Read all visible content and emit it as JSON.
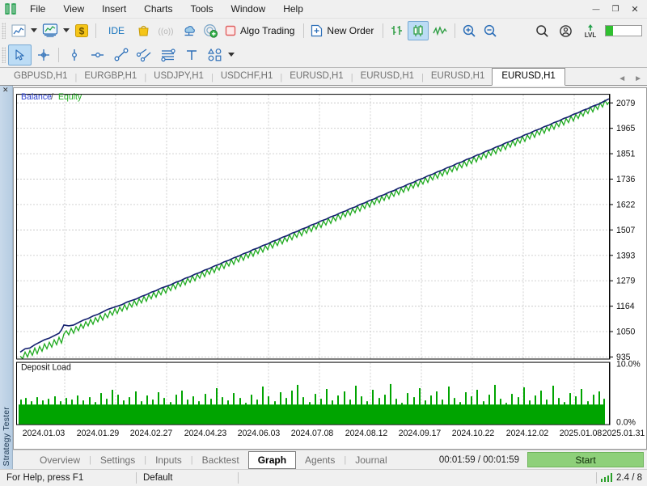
{
  "window": {
    "controls": [
      {
        "name": "minimize-button",
        "glyph": "—"
      },
      {
        "name": "restore-button",
        "glyph": "❐"
      },
      {
        "name": "close-button",
        "glyph": "✕"
      }
    ]
  },
  "menubar": {
    "logo_name": "metatrader-logo-icon",
    "items": [
      {
        "label": "File"
      },
      {
        "label": "View"
      },
      {
        "label": "Insert"
      },
      {
        "label": "Charts"
      },
      {
        "label": "Tools"
      },
      {
        "label": "Window"
      },
      {
        "label": "Help"
      }
    ]
  },
  "toolbar": {
    "items": [
      {
        "name": "chart-type-line-button",
        "icon": "line-chart-icon",
        "label": ""
      },
      {
        "name": "chart-type-dropdown",
        "icon": "chevron-down-icon",
        "label": ""
      },
      {
        "name": "templates-button",
        "icon": "template-chart-icon",
        "label": ""
      },
      {
        "name": "templates-dropdown",
        "icon": "chevron-down-icon",
        "label": ""
      },
      {
        "name": "toolbox-button",
        "icon": "dollar-box-icon",
        "label": ""
      },
      {
        "name": "ide-button",
        "icon": "",
        "label": "IDE"
      },
      {
        "name": "market-button",
        "icon": "shopping-bag-icon",
        "label": ""
      },
      {
        "name": "signals-button",
        "icon": "broadcast-icon",
        "label": ""
      },
      {
        "name": "vps-button",
        "icon": "cloud-icon",
        "label": ""
      },
      {
        "name": "copy-trading-button",
        "icon": "target-plus-icon",
        "label": ""
      },
      {
        "name": "algo-trading-button",
        "icon": "algo-square-icon",
        "label": "Algo Trading"
      },
      {
        "name": "new-order-button",
        "icon": "new-order-icon",
        "label": "New Order"
      },
      {
        "name": "bar-chart-button",
        "icon": "bar-chart-icon",
        "label": ""
      },
      {
        "name": "candlestick-chart-button",
        "icon": "candlestick-icon",
        "label": ""
      },
      {
        "name": "line-chart-button",
        "icon": "zigzag-line-icon",
        "label": ""
      },
      {
        "name": "zoom-in-button",
        "icon": "magnifier-plus-icon",
        "label": ""
      },
      {
        "name": "zoom-out-button",
        "icon": "magnifier-minus-icon",
        "label": ""
      }
    ],
    "algo_trading_label": "Algo Trading",
    "new_order_label": "New Order",
    "ide_label": "IDE",
    "search_icon": "search-icon",
    "account_icon": "account-circle-icon",
    "level_icon": "lvl-up-icon"
  },
  "drawing_toolbar": {
    "items": [
      {
        "name": "cursor-tool",
        "icon": "arrow-cursor-icon",
        "active": true
      },
      {
        "name": "crosshair-tool",
        "icon": "crosshair-icon",
        "active": false
      },
      {
        "name": "vertical-line-tool",
        "icon": "vertical-line-icon",
        "active": false
      },
      {
        "name": "horizontal-line-tool",
        "icon": "horizontal-line-icon",
        "active": false
      },
      {
        "name": "trendline-tool",
        "icon": "trendline-icon",
        "active": false
      },
      {
        "name": "equidistant-channel-tool",
        "icon": "channel-icon",
        "active": false
      },
      {
        "name": "fibonacci-tool",
        "icon": "fibonacci-icon",
        "active": false
      },
      {
        "name": "text-tool",
        "icon": "text-t-icon",
        "active": false
      },
      {
        "name": "shapes-tool",
        "icon": "shapes-icon",
        "active": false
      },
      {
        "name": "shapes-dropdown",
        "icon": "chevron-down-icon",
        "active": false
      }
    ]
  },
  "chart_tabs": {
    "tabs": [
      {
        "label": "GBPUSD,H1",
        "active": false
      },
      {
        "label": "EURGBP,H1",
        "active": false
      },
      {
        "label": "USDJPY,H1",
        "active": false
      },
      {
        "label": "USDCHF,H1",
        "active": false
      },
      {
        "label": "EURUSD,H1",
        "active": false
      },
      {
        "label": "EURUSD,H1",
        "active": false
      },
      {
        "label": "EURUSD,H1",
        "active": false
      },
      {
        "label": "EURUSD,H1",
        "active": true
      }
    ],
    "nav_prev": "◄",
    "nav_next": "►"
  },
  "side_panel": {
    "label": "Strategy Tester",
    "close_glyph": "✕"
  },
  "tester_tabs": {
    "tabs": [
      {
        "label": "Overview",
        "active": false
      },
      {
        "label": "Settings",
        "active": false
      },
      {
        "label": "Inputs",
        "active": false
      },
      {
        "label": "Backtest",
        "active": false
      },
      {
        "label": "Graph",
        "active": true
      },
      {
        "label": "Agents",
        "active": false
      },
      {
        "label": "Journal",
        "active": false
      }
    ],
    "timer": "00:01:59 / 00:01:59",
    "start_label": "Start"
  },
  "statusbar": {
    "help_text": "For Help, press F1",
    "profile": "Default",
    "connection": "2.4 / 8",
    "signal_icon": "signal-bars-icon"
  },
  "chart_data": {
    "type": "line",
    "title": "Balance / Equity",
    "legend": [
      {
        "label": "Balance",
        "color": "#1f2d86"
      },
      {
        "label": "/",
        "color": "#555555"
      },
      {
        "label": "Equity",
        "color": "#22aa22"
      }
    ],
    "xlabel": "",
    "ylabel": "",
    "grid": true,
    "legend_position": "top-left",
    "x_tick_labels": [
      "2024.01.03",
      "2024.01.29",
      "2024.02.27",
      "2024.04.23",
      "2024.06.03",
      "2024.07.08",
      "2024.08.12",
      "2024.09.17",
      "2024.10.22",
      "2024.12.02",
      "2025.01.08",
      "2025.01.31"
    ],
    "y_tick_labels": [
      "2079",
      "1965",
      "1851",
      "1736",
      "1622",
      "1507",
      "1393",
      "1279",
      "1164",
      "1050",
      "935"
    ],
    "ylim": [
      935,
      2079
    ],
    "series": [
      {
        "name": "Balance",
        "color": "#1f2d86",
        "values": [
          952,
          958,
          962,
          957,
          965,
          972,
          968,
          980,
          988,
          984,
          996,
          1004,
          1012,
          1008,
          1020,
          1031,
          1040,
          1036,
          1048,
          1060,
          1058,
          1070,
          1082,
          1079,
          1092,
          1100,
          1096,
          1108,
          1120,
          1116,
          1128,
          1140,
          1136,
          1148,
          1160,
          1156,
          1168,
          1180,
          1176,
          1188,
          1200,
          1196,
          1208,
          1220,
          1216,
          1228,
          1240,
          1236,
          1248,
          1260,
          1256,
          1268,
          1280,
          1276,
          1288,
          1300,
          1296,
          1308,
          1320,
          1316,
          1328,
          1340,
          1336,
          1348,
          1360,
          1356,
          1368,
          1380,
          1376,
          1388,
          1400,
          1396,
          1408,
          1420,
          1416,
          1428,
          1440,
          1436,
          1448,
          1460,
          1456,
          1468,
          1480,
          1476,
          1488,
          1500,
          1496,
          1508,
          1520,
          1516,
          1528,
          1540,
          1536,
          1548,
          1560,
          1556,
          1568,
          1580,
          1576,
          1588,
          1600,
          1596,
          1608,
          1620,
          1616,
          1628,
          1640,
          1636,
          1648,
          1660,
          1656,
          1668,
          1680,
          1676,
          1688,
          1700,
          1696,
          1708,
          1720,
          1716,
          1728,
          1740,
          1736,
          1748,
          1760,
          1756,
          1768,
          1780,
          1776,
          1788,
          1800,
          1796,
          1808,
          1820,
          1816,
          1828,
          1840,
          1836,
          1848,
          1860,
          1856,
          1868,
          1880,
          1876,
          1888,
          1900,
          1896,
          1908,
          1920,
          1916,
          1928,
          1940,
          1936,
          1948,
          1960,
          1956,
          1968,
          1980,
          1976,
          1988,
          2000,
          1996,
          2008,
          2020,
          2016,
          2028,
          2040,
          2036,
          2048,
          2058,
          2054,
          2064,
          2070,
          2066,
          2072,
          2076,
          2079
        ]
      },
      {
        "name": "Equity",
        "color": "#22aa22",
        "note": "Equity oscillates just below/around the balance line"
      }
    ],
    "subchart": {
      "title": "Deposit Load",
      "type": "bar",
      "color": "#00a000",
      "y_tick_labels": [
        "10.0%",
        "0.0%"
      ],
      "ylim": [
        0,
        10
      ],
      "unit": "%"
    }
  }
}
